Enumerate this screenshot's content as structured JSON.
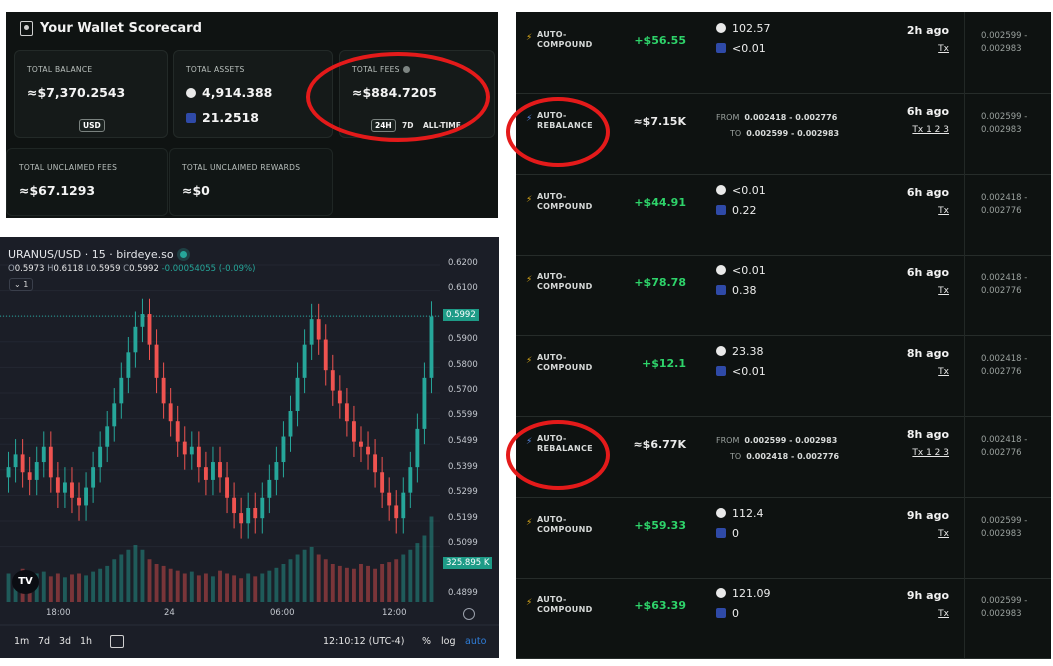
{
  "scorecard": {
    "title": "Your Wallet Scorecard",
    "total_balance": {
      "label": "TOTAL BALANCE",
      "value": "≈$7,370.2543",
      "currency": "USD"
    },
    "total_assets": {
      "label": "TOTAL ASSETS",
      "token1": "4,914.388",
      "token2": "21.2518"
    },
    "total_fees": {
      "label": "TOTAL FEES",
      "value": "≈$884.7205",
      "tabs": [
        "24H",
        "7D",
        "ALL-TIME"
      ]
    },
    "unclaimed_fees": {
      "label": "TOTAL UNCLAIMED FEES",
      "value": "≈$67.1293"
    },
    "unclaimed_rewards": {
      "label": "TOTAL UNCLAIMED REWARDS",
      "value": "≈$0"
    }
  },
  "chart": {
    "header": "URANUS/USD · 15 · birdeye.so",
    "ohlc": {
      "o": "0.5973",
      "h": "0.6118",
      "l": "0.5959",
      "c": "0.5992",
      "chg": "-0.00054055 (-0.09%)"
    },
    "volume_toggle": "⌄ 1",
    "price_tag": "0.5992",
    "volume_tag": "325.895 K",
    "tv_logo": "TV",
    "timeframes": [
      "1m",
      "7d",
      "3d",
      "1h"
    ],
    "clock": "12:10:12 (UTC-4)",
    "opts": [
      "%",
      "log",
      "auto"
    ],
    "colors": {
      "up": "#26a69a",
      "down": "#ef5350",
      "bg": "#1b1e27"
    }
  },
  "chart_data": {
    "type": "candlestick",
    "x_ticks": [
      "18:00",
      "24",
      "06:00",
      "12:00"
    ],
    "y_ticks": [
      "0.6200",
      "0.6100",
      "0.5900",
      "0.5800",
      "0.5700",
      "0.5599",
      "0.5499",
      "0.5399",
      "0.5299",
      "0.5199",
      "0.5099",
      "0.4899"
    ],
    "last_price": 0.5992,
    "closes": [
      0.54,
      0.545,
      0.538,
      0.535,
      0.542,
      0.548,
      0.536,
      0.53,
      0.534,
      0.528,
      0.525,
      0.532,
      0.54,
      0.548,
      0.556,
      0.565,
      0.575,
      0.585,
      0.595,
      0.6,
      0.588,
      0.575,
      0.565,
      0.558,
      0.55,
      0.545,
      0.548,
      0.54,
      0.535,
      0.542,
      0.536,
      0.528,
      0.522,
      0.518,
      0.524,
      0.52,
      0.528,
      0.535,
      0.542,
      0.552,
      0.562,
      0.575,
      0.588,
      0.598,
      0.59,
      0.578,
      0.57,
      0.565,
      0.558,
      0.55,
      0.548,
      0.545,
      0.538,
      0.53,
      0.525,
      0.52,
      0.53,
      0.54,
      0.555,
      0.575,
      0.599
    ],
    "volumes": [
      0.3,
      0.25,
      0.35,
      0.28,
      0.3,
      0.32,
      0.27,
      0.3,
      0.26,
      0.29,
      0.3,
      0.28,
      0.32,
      0.35,
      0.38,
      0.45,
      0.5,
      0.55,
      0.6,
      0.55,
      0.45,
      0.4,
      0.38,
      0.35,
      0.33,
      0.3,
      0.32,
      0.28,
      0.3,
      0.27,
      0.33,
      0.3,
      0.28,
      0.25,
      0.3,
      0.27,
      0.3,
      0.33,
      0.36,
      0.4,
      0.45,
      0.5,
      0.55,
      0.58,
      0.5,
      0.45,
      0.4,
      0.38,
      0.36,
      0.35,
      0.4,
      0.38,
      0.35,
      0.4,
      0.42,
      0.45,
      0.5,
      0.55,
      0.62,
      0.7,
      0.9
    ]
  },
  "activity": [
    {
      "type": "AUTO-\nCOMPOUND",
      "amount": "+$56.55",
      "t1": "102.57",
      "t2": "<0.01",
      "time": "2h ago",
      "tx": "Tx",
      "p1": "0.002599 -",
      "p2": "0.002983"
    },
    {
      "type": "AUTO-\nREBALANCE",
      "amount": "≈$7.15K",
      "from_k": "FROM",
      "from": "0.002418 - 0.002776",
      "to_k": "TO",
      "to": "0.002599 - 0.002983",
      "time": "6h ago",
      "tx": "Tx 1 2 3",
      "p1": "0.002599 -",
      "p2": "0.002983"
    },
    {
      "type": "AUTO-\nCOMPOUND",
      "amount": "+$44.91",
      "t1": "<0.01",
      "t2": "0.22",
      "time": "6h ago",
      "tx": "Tx",
      "p1": "0.002418 -",
      "p2": "0.002776"
    },
    {
      "type": "AUTO-\nCOMPOUND",
      "amount": "+$78.78",
      "t1": "<0.01",
      "t2": "0.38",
      "time": "6h ago",
      "tx": "Tx",
      "p1": "0.002418 -",
      "p2": "0.002776"
    },
    {
      "type": "AUTO-\nCOMPOUND",
      "amount": "+$12.1",
      "t1": "23.38",
      "t2": "<0.01",
      "time": "8h ago",
      "tx": "Tx",
      "p1": "0.002418 -",
      "p2": "0.002776"
    },
    {
      "type": "AUTO-\nREBALANCE",
      "amount": "≈$6.77K",
      "from_k": "FROM",
      "from": "0.002599 - 0.002983",
      "to_k": "TO",
      "to": "0.002418 - 0.002776",
      "time": "8h ago",
      "tx": "Tx 1 2 3",
      "p1": "0.002418 -",
      "p2": "0.002776"
    },
    {
      "type": "AUTO-\nCOMPOUND",
      "amount": "+$59.33",
      "t1": "112.4",
      "t2": "0",
      "time": "9h ago",
      "tx": "Tx",
      "p1": "0.002599 -",
      "p2": "0.002983"
    },
    {
      "type": "AUTO-\nCOMPOUND",
      "amount": "+$63.39",
      "t1": "121.09",
      "t2": "0",
      "time": "9h ago",
      "tx": "Tx",
      "p1": "0.002599 -",
      "p2": "0.002983"
    }
  ]
}
